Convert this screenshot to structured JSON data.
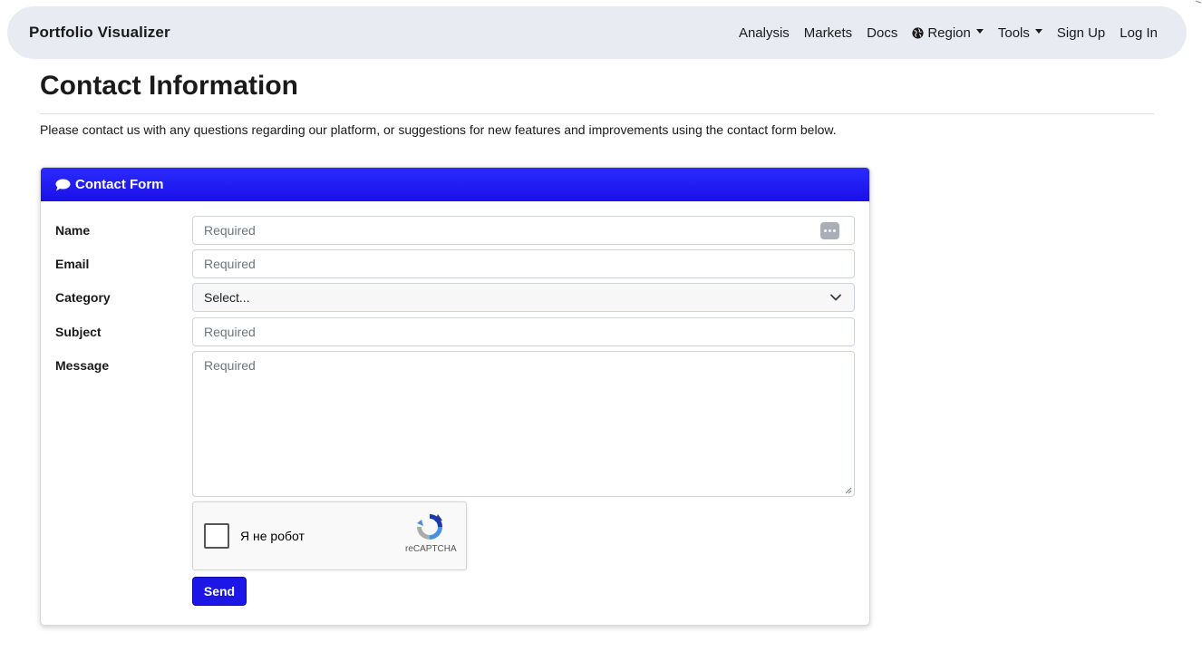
{
  "navbar": {
    "brand": "Portfolio Visualizer",
    "items": [
      {
        "label": "Analysis",
        "dropdown": false,
        "icon": ""
      },
      {
        "label": "Markets",
        "dropdown": false,
        "icon": ""
      },
      {
        "label": "Docs",
        "dropdown": false,
        "icon": ""
      },
      {
        "label": "Region",
        "dropdown": true,
        "icon": "globe-icon"
      },
      {
        "label": "Tools",
        "dropdown": true,
        "icon": ""
      },
      {
        "label": "Sign Up",
        "dropdown": false,
        "icon": ""
      },
      {
        "label": "Log In",
        "dropdown": false,
        "icon": ""
      }
    ]
  },
  "page": {
    "title": "Contact Information",
    "intro": "Please contact us with any questions regarding our platform, or suggestions for new features and improvements using the contact form below."
  },
  "form": {
    "header": "Contact Form",
    "header_icon": "chat-bubble-icon",
    "fields": {
      "name": {
        "label": "Name",
        "placeholder": "Required"
      },
      "email": {
        "label": "Email",
        "placeholder": "Required"
      },
      "category": {
        "label": "Category",
        "value": "Select..."
      },
      "subject": {
        "label": "Subject",
        "placeholder": "Required"
      },
      "message": {
        "label": "Message",
        "placeholder": "Required"
      }
    },
    "captcha": {
      "label": "Я не робот",
      "brand": "reCAPTCHA"
    },
    "send_label": "Send"
  },
  "colors": {
    "navbar_bg": "#e8ebf2",
    "accent": "#1c16e6"
  }
}
